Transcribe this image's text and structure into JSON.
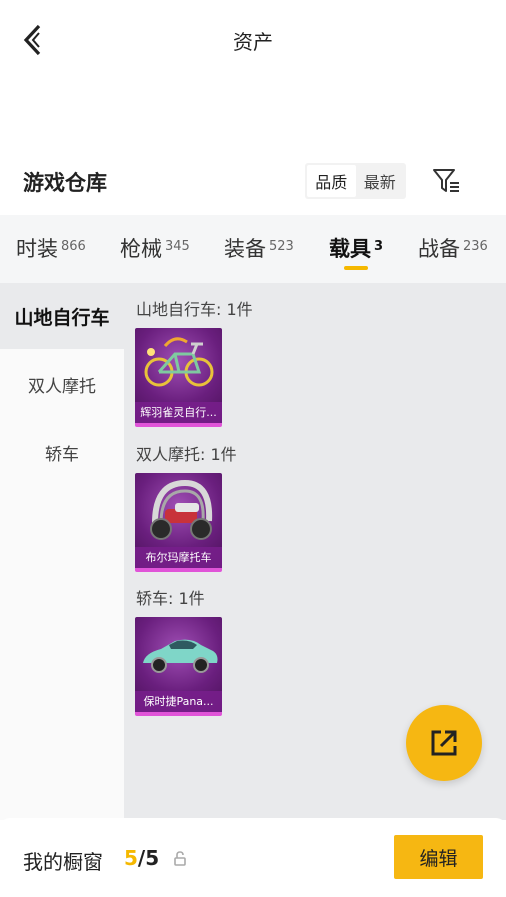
{
  "header": {
    "title": "资产"
  },
  "section": {
    "title": "游戏仓库",
    "sort_options": [
      "品质",
      "最新"
    ]
  },
  "tabs": [
    {
      "label": "时装",
      "count": "866"
    },
    {
      "label": "枪械",
      "count": "345"
    },
    {
      "label": "装备",
      "count": "523"
    },
    {
      "label": "载具",
      "count": "3"
    },
    {
      "label": "战备",
      "count": "236"
    }
  ],
  "sidebar": {
    "items": [
      {
        "label": "山地自行车"
      },
      {
        "label": "双人摩托"
      },
      {
        "label": "轿车"
      }
    ]
  },
  "groups": [
    {
      "label": "山地自行车: 1件",
      "item_name": "辉羽雀灵自行...",
      "icon": "bicycle-icon"
    },
    {
      "label": "双人摩托: 1件",
      "item_name": "布尔玛摩托车",
      "icon": "motorcycle-icon"
    },
    {
      "label": "轿车: 1件",
      "item_name": "保时捷Pana...",
      "icon": "sports-car-icon"
    }
  ],
  "footer": {
    "showcase_label": "我的橱窗",
    "showcase_current": "5",
    "showcase_total": "/5",
    "edit_label": "编辑"
  },
  "colors": {
    "accent": "#f6b712",
    "rarity_purple": "#6a1f7e"
  }
}
